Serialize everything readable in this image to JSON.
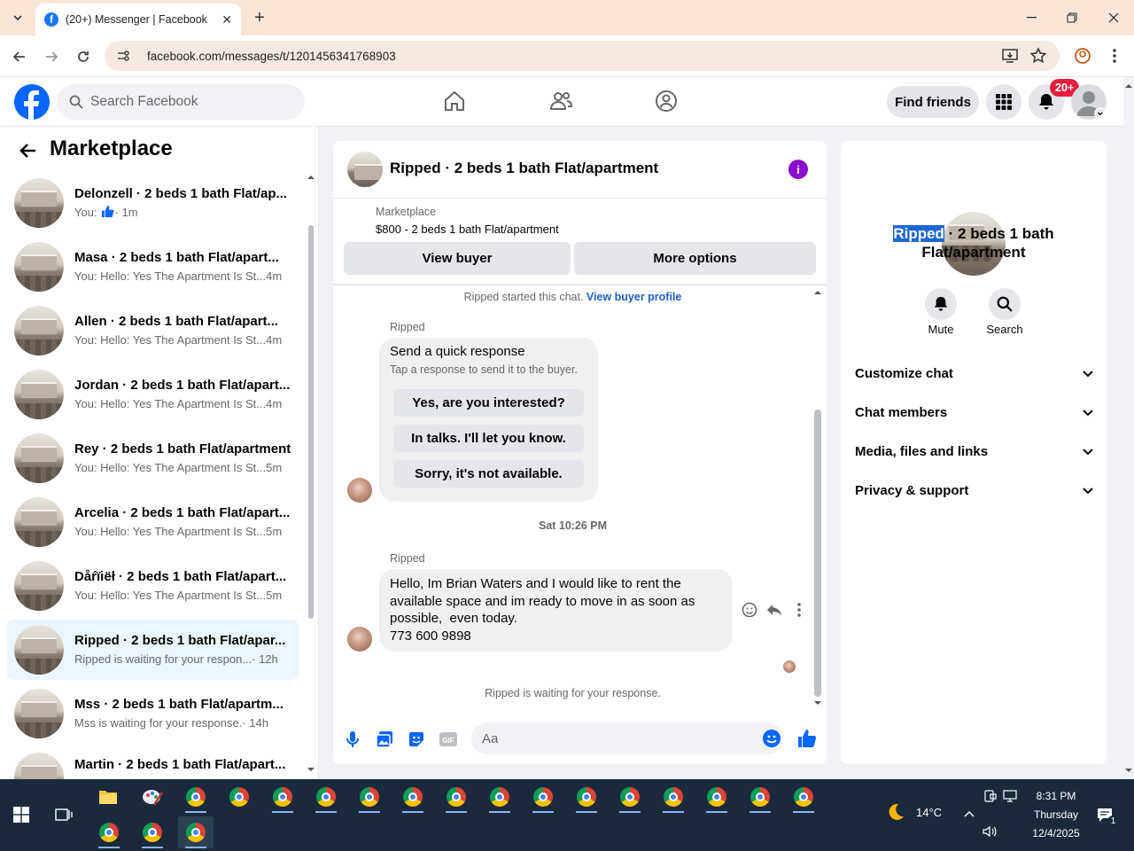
{
  "browser": {
    "tab_title": "(20+) Messenger | Facebook",
    "url": "facebook.com/messages/t/1201456341768903"
  },
  "fb_header": {
    "search_placeholder": "Search Facebook",
    "find_friends": "Find friends",
    "notif_badge": "20+"
  },
  "left": {
    "title": "Marketplace",
    "conversations": [
      {
        "name": "Delonzell · 2 beds 1 bath Flat/ap...",
        "preview": "You:",
        "time": " · 1m",
        "thumb_icon": "like-icon"
      },
      {
        "name": "Masa · 2 beds 1 bath Flat/apart...",
        "preview": "You: Hello: Yes The Apartment Is St...",
        "time": " 4m"
      },
      {
        "name": "Allen · 2 beds 1 bath Flat/apart...",
        "preview": "You: Hello: Yes The Apartment Is St...",
        "time": " 4m"
      },
      {
        "name": "Jordan · 2 beds 1 bath Flat/apart...",
        "preview": "You: Hello: Yes The Apartment Is St...",
        "time": " 4m"
      },
      {
        "name": "Rey · 2 beds 1 bath Flat/apartment",
        "preview": "You: Hello: Yes The Apartment Is St...",
        "time": " 5m"
      },
      {
        "name": "Arcelia · 2 beds 1 bath Flat/apart...",
        "preview": "You: Hello: Yes The Apartment Is St...",
        "time": " 5m"
      },
      {
        "name": "Dåŕïiëł · 2 beds 1 bath Flat/apart...",
        "preview": "You: Hello: Yes The Apartment Is St...",
        "time": " 5m"
      },
      {
        "name": "Ripped · 2 beds 1 bath Flat/apar...",
        "preview": "Ripped is waiting for your respon...",
        "time": " · 12h"
      },
      {
        "name": "Mss · 2 beds 1 bath Flat/apartm...",
        "preview": "Mss is waiting for your response.",
        "time": " · 14h"
      },
      {
        "name": "Martin · 2 beds 1 bath Flat/apart...",
        "preview": "",
        "time": ""
      }
    ]
  },
  "chat": {
    "title": "Ripped · 2 beds 1 bath Flat/apartment",
    "marketplace_label": "Marketplace",
    "listing": "$800 - 2 beds 1 bath Flat/apartment",
    "view_buyer": "View buyer",
    "more_options": "More options",
    "started_text": "Ripped started this chat.",
    "view_buyer_profile": "View buyer profile",
    "sender": "Ripped",
    "quick_title": "Send a quick response",
    "quick_sub": "Tap a response to send it to the buyer.",
    "quick_replies": [
      "Yes, are you interested?",
      "In talks. I'll let you know.",
      "Sorry, it's not available."
    ],
    "date_sep": "Sat 10:26 PM",
    "message_lines": [
      "Hello, Im Brian Waters and I would like to rent the",
      "available space and im ready to move in as soon as",
      "possible,  even today.",
      "773 600 9898"
    ],
    "waiting": "Ripped is waiting for your response.",
    "composer_placeholder": "Aa"
  },
  "right": {
    "title_highlight": "Ripped",
    "title_rest": " · 2 beds 1 bath",
    "title_line2": "Flat/apartment",
    "mute": "Mute",
    "search": "Search",
    "rows": [
      "Customize chat",
      "Chat members",
      "Media, files and links",
      "Privacy & support"
    ]
  },
  "taskbar": {
    "temp": "14°C",
    "time": "8:31 PM",
    "day": "Thursday",
    "date": "12/4/2025",
    "notif_count": "1"
  },
  "colors": {
    "fb_blue": "#0866ff",
    "badge_red": "#e41e3f",
    "selected_row": "#ebf5ff",
    "tab_bar": "#fbe5d9"
  }
}
